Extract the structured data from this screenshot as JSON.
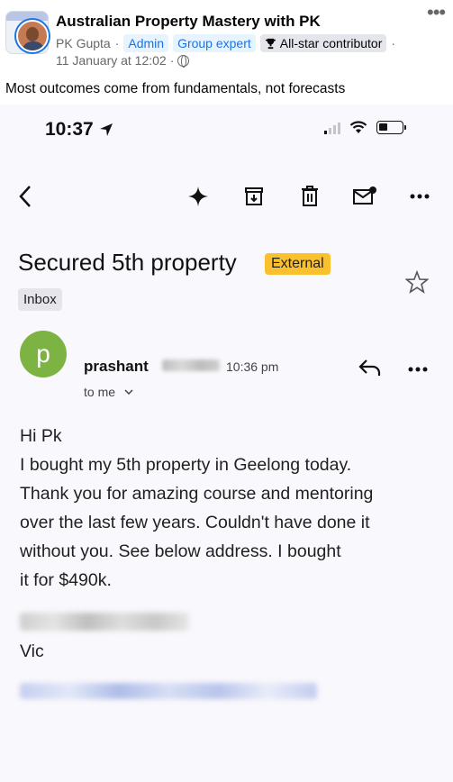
{
  "post": {
    "group_name": "Australian Property Mastery with PK",
    "author": "PK Gupta",
    "separator": "·",
    "badges": [
      "Admin",
      "Group expert",
      "All-star contributor"
    ],
    "date": "11 January at 12:02",
    "caption": "Most outcomes come from fundamentals, not forecasts"
  },
  "phone": {
    "status_time": "10:37",
    "email": {
      "subject": "Secured 5th property",
      "external_label": "External",
      "label_chip": "Inbox",
      "sender_initial": "p",
      "sender_name": "prashant",
      "sent_time": "10:36 pm",
      "recipient": "to me",
      "body_lines": [
        "Hi Pk",
        "I bought my 5th property in Geelong today.",
        "Thank you for amazing course and mentoring",
        "over the last few years. Couldn't have done it",
        "without you. See below address. I bought",
        "it for $490k."
      ],
      "address_state": "Vic"
    }
  },
  "colors": {
    "accent_blue": "#1b74e4",
    "external_badge": "#fbc02d",
    "sender_avatar": "#7cb342"
  }
}
